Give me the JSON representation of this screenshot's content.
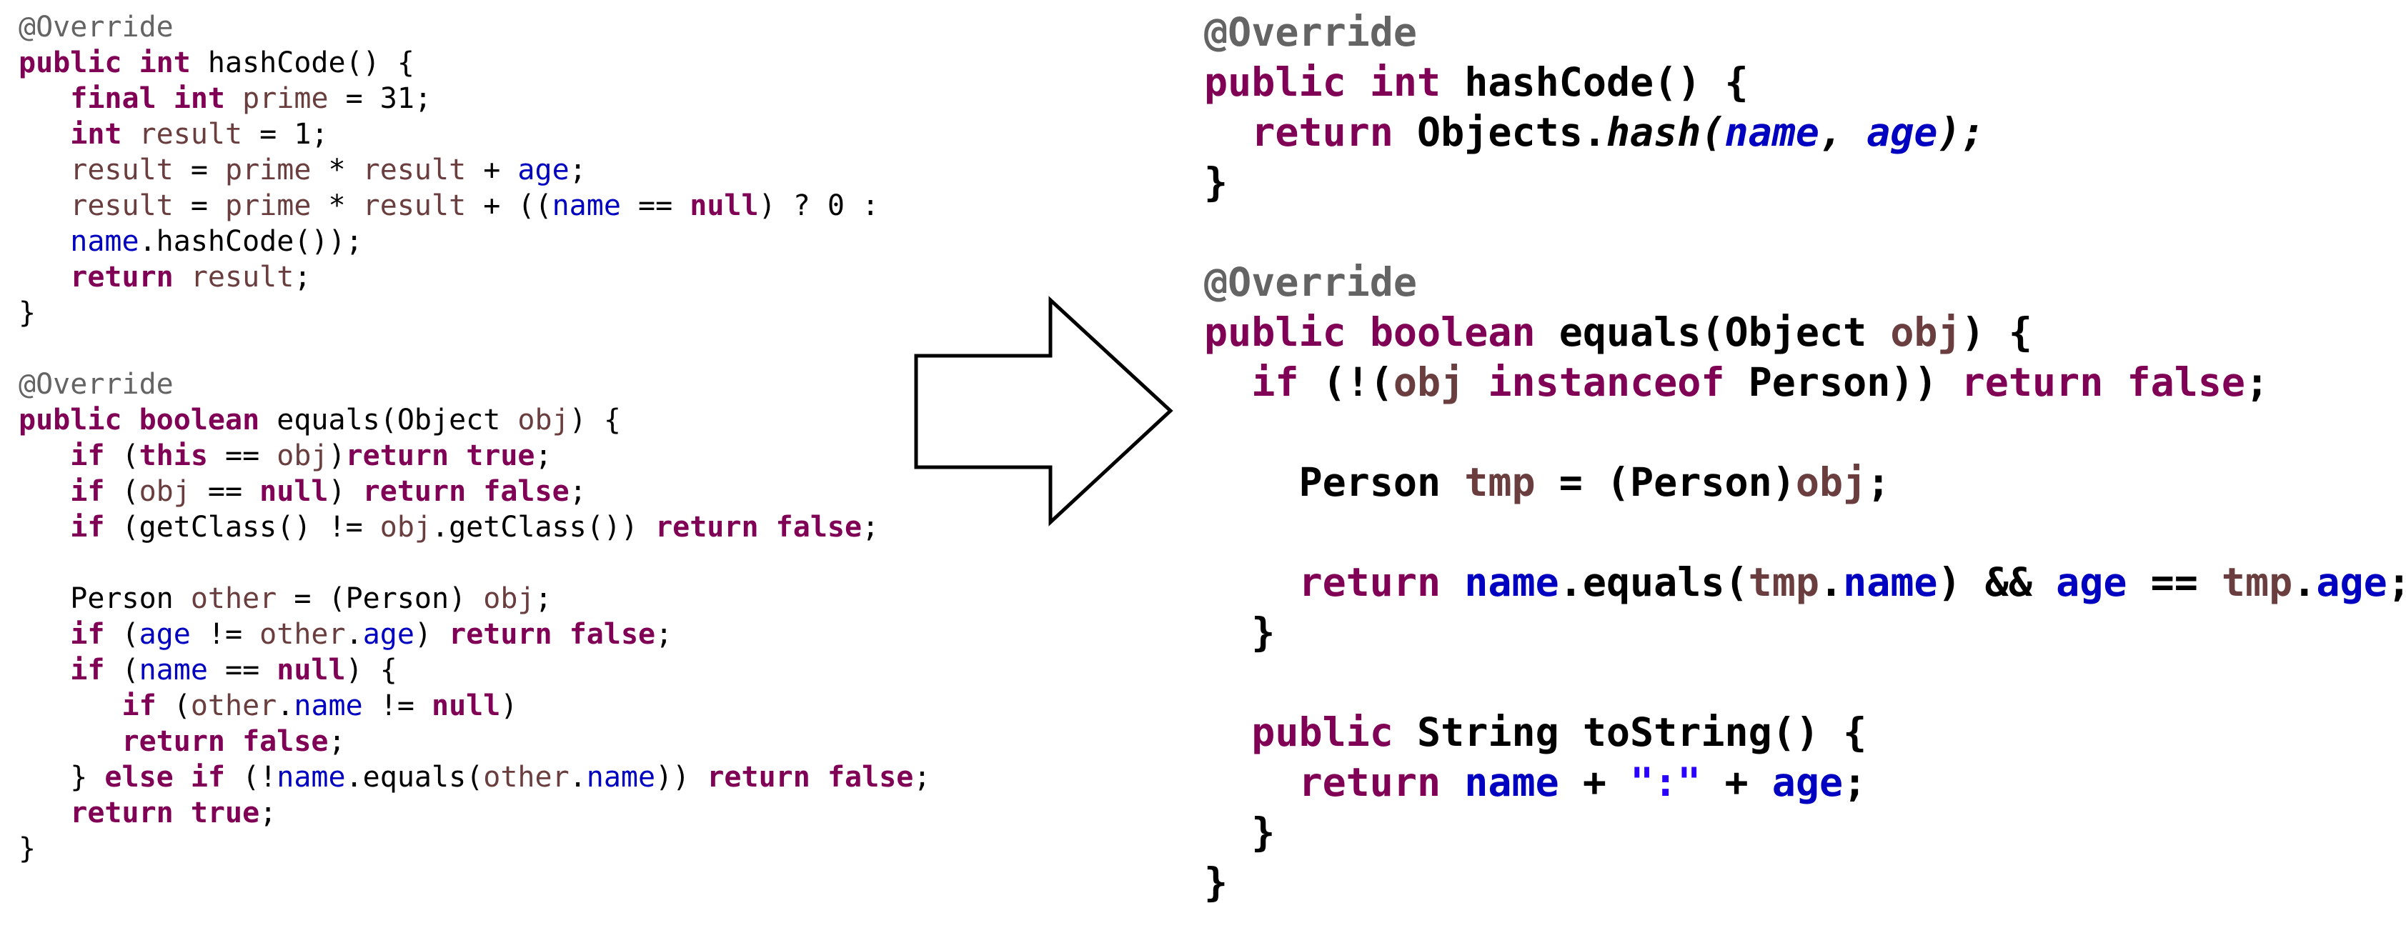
{
  "left_code": {
    "lines": [
      [
        {
          "t": "@Override",
          "c": "anno"
        }
      ],
      [
        {
          "t": "public",
          "c": "kw"
        },
        {
          "t": " ",
          "c": "plain"
        },
        {
          "t": "int",
          "c": "kw"
        },
        {
          "t": " hashCode() {",
          "c": "plain"
        }
      ],
      [
        {
          "t": "   ",
          "c": "plain"
        },
        {
          "t": "final",
          "c": "kw"
        },
        {
          "t": " ",
          "c": "plain"
        },
        {
          "t": "int",
          "c": "kw"
        },
        {
          "t": " ",
          "c": "plain"
        },
        {
          "t": "prime",
          "c": "loc"
        },
        {
          "t": " = 31;",
          "c": "plain"
        }
      ],
      [
        {
          "t": "   ",
          "c": "plain"
        },
        {
          "t": "int",
          "c": "kw"
        },
        {
          "t": " ",
          "c": "plain"
        },
        {
          "t": "result",
          "c": "loc"
        },
        {
          "t": " = 1;",
          "c": "plain"
        }
      ],
      [
        {
          "t": "   ",
          "c": "plain"
        },
        {
          "t": "result",
          "c": "loc"
        },
        {
          "t": " = ",
          "c": "plain"
        },
        {
          "t": "prime",
          "c": "loc"
        },
        {
          "t": " * ",
          "c": "plain"
        },
        {
          "t": "result",
          "c": "loc"
        },
        {
          "t": " + ",
          "c": "plain"
        },
        {
          "t": "age",
          "c": "fld"
        },
        {
          "t": ";",
          "c": "plain"
        }
      ],
      [
        {
          "t": "   ",
          "c": "plain"
        },
        {
          "t": "result",
          "c": "loc"
        },
        {
          "t": " = ",
          "c": "plain"
        },
        {
          "t": "prime",
          "c": "loc"
        },
        {
          "t": " * ",
          "c": "plain"
        },
        {
          "t": "result",
          "c": "loc"
        },
        {
          "t": " + ((",
          "c": "plain"
        },
        {
          "t": "name",
          "c": "fld"
        },
        {
          "t": " == ",
          "c": "plain"
        },
        {
          "t": "null",
          "c": "kw"
        },
        {
          "t": ") ? 0 :",
          "c": "plain"
        }
      ],
      [
        {
          "t": "   ",
          "c": "plain"
        },
        {
          "t": "name",
          "c": "fld"
        },
        {
          "t": ".hashCode());",
          "c": "plain"
        }
      ],
      [
        {
          "t": "   ",
          "c": "plain"
        },
        {
          "t": "return",
          "c": "kw"
        },
        {
          "t": " ",
          "c": "plain"
        },
        {
          "t": "result",
          "c": "loc"
        },
        {
          "t": ";",
          "c": "plain"
        }
      ],
      [
        {
          "t": "}",
          "c": "plain"
        }
      ],
      [],
      [
        {
          "t": "@Override",
          "c": "anno"
        }
      ],
      [
        {
          "t": "public",
          "c": "kw"
        },
        {
          "t": " ",
          "c": "plain"
        },
        {
          "t": "boolean",
          "c": "kw"
        },
        {
          "t": " equals(Object ",
          "c": "plain"
        },
        {
          "t": "obj",
          "c": "loc"
        },
        {
          "t": ") {",
          "c": "plain"
        }
      ],
      [
        {
          "t": "   ",
          "c": "plain"
        },
        {
          "t": "if",
          "c": "kw"
        },
        {
          "t": " (",
          "c": "plain"
        },
        {
          "t": "this",
          "c": "kw"
        },
        {
          "t": " == ",
          "c": "plain"
        },
        {
          "t": "obj",
          "c": "loc"
        },
        {
          "t": ")",
          "c": "plain"
        },
        {
          "t": "return",
          "c": "kw"
        },
        {
          "t": " ",
          "c": "plain"
        },
        {
          "t": "true",
          "c": "kw"
        },
        {
          "t": ";",
          "c": "plain"
        }
      ],
      [
        {
          "t": "   ",
          "c": "plain"
        },
        {
          "t": "if",
          "c": "kw"
        },
        {
          "t": " (",
          "c": "plain"
        },
        {
          "t": "obj",
          "c": "loc"
        },
        {
          "t": " == ",
          "c": "plain"
        },
        {
          "t": "null",
          "c": "kw"
        },
        {
          "t": ") ",
          "c": "plain"
        },
        {
          "t": "return",
          "c": "kw"
        },
        {
          "t": " ",
          "c": "plain"
        },
        {
          "t": "false",
          "c": "kw"
        },
        {
          "t": ";",
          "c": "plain"
        }
      ],
      [
        {
          "t": "   ",
          "c": "plain"
        },
        {
          "t": "if",
          "c": "kw"
        },
        {
          "t": " (getClass() != ",
          "c": "plain"
        },
        {
          "t": "obj",
          "c": "loc"
        },
        {
          "t": ".getClass()) ",
          "c": "plain"
        },
        {
          "t": "return",
          "c": "kw"
        },
        {
          "t": " ",
          "c": "plain"
        },
        {
          "t": "false",
          "c": "kw"
        },
        {
          "t": ";",
          "c": "plain"
        }
      ],
      [],
      [
        {
          "t": "   Person ",
          "c": "plain"
        },
        {
          "t": "other",
          "c": "loc"
        },
        {
          "t": " = (Person) ",
          "c": "plain"
        },
        {
          "t": "obj",
          "c": "loc"
        },
        {
          "t": ";",
          "c": "plain"
        }
      ],
      [
        {
          "t": "   ",
          "c": "plain"
        },
        {
          "t": "if",
          "c": "kw"
        },
        {
          "t": " (",
          "c": "plain"
        },
        {
          "t": "age",
          "c": "fld"
        },
        {
          "t": " != ",
          "c": "plain"
        },
        {
          "t": "other",
          "c": "loc"
        },
        {
          "t": ".",
          "c": "plain"
        },
        {
          "t": "age",
          "c": "fld"
        },
        {
          "t": ") ",
          "c": "plain"
        },
        {
          "t": "return",
          "c": "kw"
        },
        {
          "t": " ",
          "c": "plain"
        },
        {
          "t": "false",
          "c": "kw"
        },
        {
          "t": ";",
          "c": "plain"
        }
      ],
      [
        {
          "t": "   ",
          "c": "plain"
        },
        {
          "t": "if",
          "c": "kw"
        },
        {
          "t": " (",
          "c": "plain"
        },
        {
          "t": "name",
          "c": "fld"
        },
        {
          "t": " == ",
          "c": "plain"
        },
        {
          "t": "null",
          "c": "kw"
        },
        {
          "t": ") {",
          "c": "plain"
        }
      ],
      [
        {
          "t": "      ",
          "c": "plain"
        },
        {
          "t": "if",
          "c": "kw"
        },
        {
          "t": " (",
          "c": "plain"
        },
        {
          "t": "other",
          "c": "loc"
        },
        {
          "t": ".",
          "c": "plain"
        },
        {
          "t": "name",
          "c": "fld"
        },
        {
          "t": " != ",
          "c": "plain"
        },
        {
          "t": "null",
          "c": "kw"
        },
        {
          "t": ")",
          "c": "plain"
        }
      ],
      [
        {
          "t": "      ",
          "c": "plain"
        },
        {
          "t": "return",
          "c": "kw"
        },
        {
          "t": " ",
          "c": "plain"
        },
        {
          "t": "false",
          "c": "kw"
        },
        {
          "t": ";",
          "c": "plain"
        }
      ],
      [
        {
          "t": "   } ",
          "c": "plain"
        },
        {
          "t": "else",
          "c": "kw"
        },
        {
          "t": " ",
          "c": "plain"
        },
        {
          "t": "if",
          "c": "kw"
        },
        {
          "t": " (!",
          "c": "plain"
        },
        {
          "t": "name",
          "c": "fld"
        },
        {
          "t": ".equals(",
          "c": "plain"
        },
        {
          "t": "other",
          "c": "loc"
        },
        {
          "t": ".",
          "c": "plain"
        },
        {
          "t": "name",
          "c": "fld"
        },
        {
          "t": ")) ",
          "c": "plain"
        },
        {
          "t": "return",
          "c": "kw"
        },
        {
          "t": " ",
          "c": "plain"
        },
        {
          "t": "false",
          "c": "kw"
        },
        {
          "t": ";",
          "c": "plain"
        }
      ],
      [
        {
          "t": "   ",
          "c": "plain"
        },
        {
          "t": "return",
          "c": "kw"
        },
        {
          "t": " ",
          "c": "plain"
        },
        {
          "t": "true",
          "c": "kw"
        },
        {
          "t": ";",
          "c": "plain"
        }
      ],
      [
        {
          "t": "}",
          "c": "plain"
        }
      ]
    ]
  },
  "right_code": {
    "lines": [
      [
        {
          "t": "@Override",
          "c": "anno"
        }
      ],
      [
        {
          "t": "public",
          "c": "kw"
        },
        {
          "t": " ",
          "c": "plain"
        },
        {
          "t": "int",
          "c": "kw"
        },
        {
          "t": " hashCode() {",
          "c": "plain"
        }
      ],
      [
        {
          "t": "  ",
          "c": "plain"
        },
        {
          "t": "return",
          "c": "kw"
        },
        {
          "t": " Objects.",
          "c": "plain"
        },
        {
          "t": "hash(",
          "c": "plain ital"
        },
        {
          "t": "name",
          "c": "fld ital"
        },
        {
          "t": ", ",
          "c": "plain ital"
        },
        {
          "t": "age",
          "c": "fld ital"
        },
        {
          "t": ");",
          "c": "plain ital"
        }
      ],
      [
        {
          "t": "}",
          "c": "plain"
        }
      ],
      [],
      [
        {
          "t": "@Override",
          "c": "anno"
        }
      ],
      [
        {
          "t": "public",
          "c": "kw"
        },
        {
          "t": " ",
          "c": "plain"
        },
        {
          "t": "boolean",
          "c": "kw"
        },
        {
          "t": " equals(Object ",
          "c": "plain"
        },
        {
          "t": "obj",
          "c": "loc"
        },
        {
          "t": ") {",
          "c": "plain"
        }
      ],
      [
        {
          "t": "  ",
          "c": "plain"
        },
        {
          "t": "if",
          "c": "kw"
        },
        {
          "t": " (!(",
          "c": "plain"
        },
        {
          "t": "obj",
          "c": "loc"
        },
        {
          "t": " ",
          "c": "plain"
        },
        {
          "t": "instanceof",
          "c": "kw"
        },
        {
          "t": " Person)) ",
          "c": "plain"
        },
        {
          "t": "return",
          "c": "kw"
        },
        {
          "t": " ",
          "c": "plain"
        },
        {
          "t": "false",
          "c": "kw"
        },
        {
          "t": ";",
          "c": "plain"
        }
      ],
      [],
      [
        {
          "t": "    Person ",
          "c": "plain"
        },
        {
          "t": "tmp",
          "c": "loc"
        },
        {
          "t": " = (Person)",
          "c": "plain"
        },
        {
          "t": "obj",
          "c": "loc"
        },
        {
          "t": ";",
          "c": "plain"
        }
      ],
      [],
      [
        {
          "t": "    ",
          "c": "plain"
        },
        {
          "t": "return",
          "c": "kw"
        },
        {
          "t": " ",
          "c": "plain"
        },
        {
          "t": "name",
          "c": "fld"
        },
        {
          "t": ".equals(",
          "c": "plain"
        },
        {
          "t": "tmp",
          "c": "loc"
        },
        {
          "t": ".",
          "c": "plain"
        },
        {
          "t": "name",
          "c": "fld"
        },
        {
          "t": ") && ",
          "c": "plain"
        },
        {
          "t": "age",
          "c": "fld"
        },
        {
          "t": " == ",
          "c": "plain"
        },
        {
          "t": "tmp",
          "c": "loc"
        },
        {
          "t": ".",
          "c": "plain"
        },
        {
          "t": "age",
          "c": "fld"
        },
        {
          "t": ";",
          "c": "plain"
        }
      ],
      [
        {
          "t": "  }",
          "c": "plain"
        }
      ],
      [],
      [
        {
          "t": "  ",
          "c": "plain"
        },
        {
          "t": "public",
          "c": "kw"
        },
        {
          "t": " String toString() {",
          "c": "plain"
        }
      ],
      [
        {
          "t": "    ",
          "c": "plain"
        },
        {
          "t": "return",
          "c": "kw"
        },
        {
          "t": " ",
          "c": "plain"
        },
        {
          "t": "name",
          "c": "fld"
        },
        {
          "t": " + ",
          "c": "plain"
        },
        {
          "t": "\":\"",
          "c": "str"
        },
        {
          "t": " + ",
          "c": "plain"
        },
        {
          "t": "age",
          "c": "fld"
        },
        {
          "t": ";",
          "c": "plain"
        }
      ],
      [
        {
          "t": "  }",
          "c": "plain"
        }
      ],
      [
        {
          "t": "}",
          "c": "plain"
        }
      ]
    ]
  },
  "colors": {
    "annotation": "#646464",
    "keyword": "#7f0055",
    "field": "#0000c0",
    "local_variable": "#6a3e3e",
    "string": "#2a00ff",
    "text": "#000000",
    "arrow_stroke": "#000000",
    "arrow_fill": "#ffffff",
    "background": "#ffffff"
  },
  "arrow": {
    "icon": "right-arrow-icon",
    "direction": "right"
  }
}
